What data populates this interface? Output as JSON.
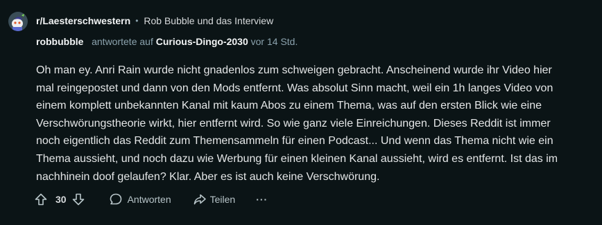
{
  "header": {
    "subreddit": "r/Laesterschwestern",
    "separator": "•",
    "post_title": "Rob Bubble und das Interview",
    "username": "robbubble",
    "replied_text": "antwortete auf",
    "replied_to_user": "Curious-Dingo-2030",
    "timestamp": "vor 14 Std."
  },
  "comment": {
    "body": "Oh man ey. Anri Rain wurde nicht gnadenlos zum schweigen gebracht. Anscheinend wurde ihr Video hier mal reingepostet und dann von den Mods entfernt. Was absolut Sinn macht, weil ein 1h langes Video von einem komplett unbekannten Kanal mit kaum Abos zu einem Thema, was auf den ersten Blick wie eine Verschwörungstheorie wirkt, hier entfernt wird. So wie ganz viele Einreichungen. Dieses Reddit ist immer noch eigentlich das Reddit zum Themensammeln für einen Podcast... Und wenn das Thema nicht wie ein Thema aussieht, und noch dazu wie Werbung für einen kleinen Kanal aussieht, wird es entfernt. Ist das im nachhinein doof gelaufen? Klar. Aber es ist auch keine Verschwörung."
  },
  "actions": {
    "vote_count": "30",
    "reply_label": "Antworten",
    "share_label": "Teilen",
    "more_label": "···"
  },
  "icons": {
    "upvote": "upvote-arrow-icon",
    "downvote": "downvote-arrow-icon",
    "reply": "speech-bubble-icon",
    "share": "share-arrow-icon",
    "more": "ellipsis-icon",
    "avatar": "snoo-avatar"
  },
  "colors": {
    "background": "#0b1416",
    "text": "#e4e6e7",
    "muted": "#8ba2ad"
  }
}
